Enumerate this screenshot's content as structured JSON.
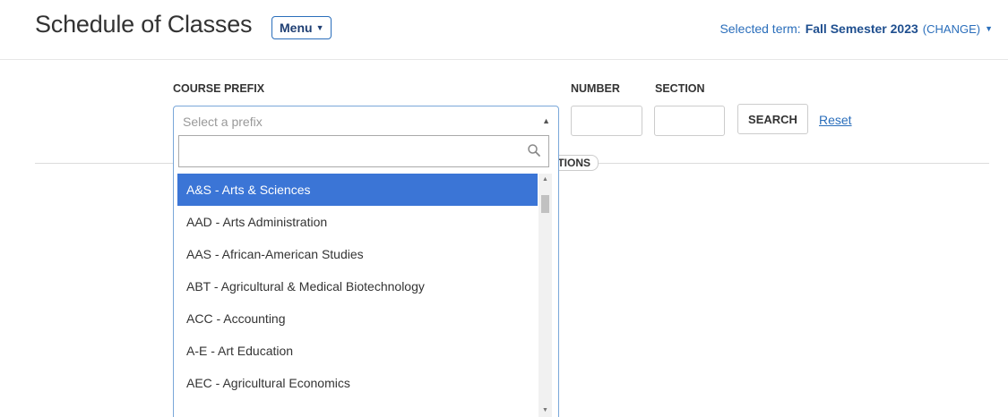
{
  "header": {
    "title": "Schedule of Classes",
    "menu_label": "Menu",
    "term_prefix": "Selected term:",
    "term_value": "Fall Semester 2023",
    "term_change": "(CHANGE)"
  },
  "search": {
    "prefix_label": "COURSE PREFIX",
    "prefix_placeholder": "Select a prefix",
    "number_label": "NUMBER",
    "number_value": "",
    "section_label": "SECTION",
    "section_value": "",
    "search_label": "SEARCH",
    "reset_label": "Reset",
    "options_tab_label": "TIONS"
  },
  "dropdown": {
    "filter_value": "",
    "items": [
      "A&S - Arts & Sciences",
      "AAD - Arts Administration",
      "AAS - African-American Studies",
      "ABT - Agricultural & Medical Biotechnology",
      "ACC - Accounting",
      "A-E - Art Education",
      "AEC - Agricultural Economics"
    ],
    "highlighted_index": 0
  },
  "colors": {
    "accent": "#2a6ebb",
    "highlight": "#3b75d6"
  }
}
